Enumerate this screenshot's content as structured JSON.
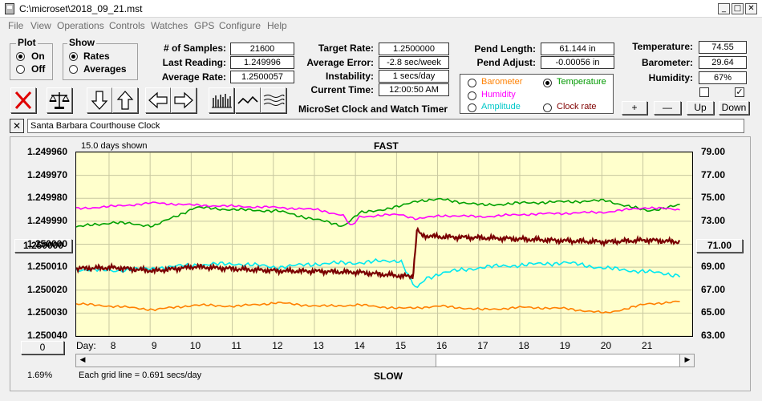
{
  "window": {
    "title": "C:\\microset\\2018_09_21.mst",
    "min_label": "_",
    "max_label": "□",
    "close_label": "✕"
  },
  "menu": [
    "File",
    "View",
    "Operations",
    "Controls",
    "Watches",
    "GPS",
    "Configure",
    "Help"
  ],
  "plot_group": {
    "title": "Plot",
    "on_label": "On",
    "off_label": "Off",
    "selected": "On"
  },
  "show_group": {
    "title": "Show",
    "rates_label": "Rates",
    "averages_label": "Averages",
    "selected": "Rates"
  },
  "stats": {
    "samples_label": "# of Samples:",
    "samples": "21600",
    "last_reading_label": "Last Reading:",
    "last_reading": "1.249996",
    "average_rate_label": "Average Rate:",
    "average_rate": "1.2500057",
    "target_rate_label": "Target Rate:",
    "target_rate": "1.2500000",
    "average_error_label": "Average Error:",
    "average_error": "-2.8 sec/week",
    "instability_label": "Instability:",
    "instability": "1 secs/day",
    "current_time_label": "Current Time:",
    "current_time": "12:00:50 AM",
    "pend_length_label": "Pend Length:",
    "pend_length": "61.144 in",
    "pend_adjust_label": "Pend Adjust:",
    "pend_adjust": "-0.00056 in",
    "temperature_label": "Temperature:",
    "temperature": "74.55",
    "barometer_label": "Barometer:",
    "barometer": "29.64",
    "humidity_label": "Humidity:",
    "humidity": "67%"
  },
  "app_name": "MicroSet Clock and Watch Timer",
  "sensors": {
    "barometer": {
      "label": "Barometer",
      "color": "#ff8000"
    },
    "temperature": {
      "label": "Temperature",
      "color": "#009900"
    },
    "humidity": {
      "label": "Humidity",
      "color": "#ff00ff"
    },
    "amplitude": {
      "label": "Amplitude",
      "color": "#00c8c8"
    },
    "clock_rate": {
      "label": "Clock rate",
      "color": "#800000"
    },
    "selected": "Temperature"
  },
  "scale_buttons": {
    "plus": "+",
    "minus": "—",
    "up": "Up",
    "down": "Down"
  },
  "checkboxes": {
    "left_checked": false,
    "right_checked": true
  },
  "toolbar_icons": [
    "clear-x-icon",
    "balance-scale-icon",
    "arrow-down-icon",
    "arrow-up-icon",
    "arrow-left-icon",
    "arrow-right-icon",
    "bar-graph-icon",
    "line-graph-icon",
    "smooth-graph-icon"
  ],
  "clock_name": "Santa Barbara Courthouse Clock",
  "clock_name_clear": "✕",
  "chart_data": {
    "type": "line",
    "title": "FAST",
    "bottom_label": "SLOW",
    "days_shown": "15.0 days shown",
    "grid_note": "Each grid line = 0.691 secs/day",
    "percent": "1.69%",
    "left_button": "1.250000",
    "left_bottom_button": "0",
    "right_button": "71.00",
    "x_label": "Day:",
    "x_ticks": [
      "8",
      "9",
      "10",
      "11",
      "12",
      "13",
      "14",
      "15",
      "16",
      "17",
      "18",
      "19",
      "20",
      "21"
    ],
    "x_range": [
      7.1,
      22.1
    ],
    "left_axis": {
      "ticks": [
        "1.249960",
        "1.249970",
        "1.249980",
        "1.249990",
        "1.250000",
        "1.250010",
        "1.250020",
        "1.250030",
        "1.250040"
      ],
      "range": [
        1.24996,
        1.25004
      ],
      "inverted": true
    },
    "right_axis": {
      "ticks": [
        "79.00",
        "77.00",
        "75.00",
        "73.00",
        "71.00",
        "69.00",
        "67.00",
        "65.00",
        "63.00"
      ],
      "range": [
        63,
        79
      ]
    },
    "grid": true,
    "series": [
      {
        "name": "Temperature",
        "color": "#00a000",
        "axis": "right",
        "x": [
          7.1,
          8,
          9,
          10,
          11,
          12,
          13,
          13.6,
          14,
          15,
          15.4,
          16,
          17,
          18,
          19,
          20,
          21,
          21.8
        ],
        "y": [
          72.5,
          72.9,
          72.6,
          74.2,
          74.0,
          73.9,
          73.1,
          72.6,
          73.7,
          74.3,
          74.8,
          74.9,
          74.4,
          74.6,
          74.7,
          74.8,
          73.9,
          74.4
        ]
      },
      {
        "name": "Humidity",
        "color": "#ff00ff",
        "axis": "right",
        "x": [
          7.1,
          8,
          9,
          10,
          11,
          12,
          13,
          13.6,
          13.8,
          14,
          15,
          15.4,
          16,
          17,
          18,
          19,
          20,
          21,
          21.8
        ],
        "y": [
          74.1,
          74.3,
          74.6,
          74.4,
          74.3,
          74.2,
          74.0,
          73.5,
          72.5,
          73.4,
          73.6,
          73.2,
          73.5,
          73.4,
          73.6,
          73.7,
          73.8,
          74.2,
          74.0
        ]
      },
      {
        "name": "Amplitude",
        "color": "#00e8f0",
        "axis": "right",
        "x": [
          7.1,
          8,
          9,
          10,
          11,
          12,
          13,
          14,
          15,
          15.3,
          15.4,
          15.6,
          16,
          17,
          18,
          19,
          20,
          21,
          21.8
        ],
        "y": [
          68.8,
          68.7,
          68.9,
          69.2,
          69.3,
          69.0,
          69.3,
          69.4,
          69.6,
          67.5,
          67.1,
          68.0,
          68.5,
          69.0,
          69.2,
          69.4,
          68.9,
          68.6,
          68.3
        ]
      },
      {
        "name": "Barometer",
        "color": "#ff8000",
        "axis": "right",
        "x": [
          7.1,
          8,
          9,
          10,
          11,
          12,
          13,
          14,
          15,
          16,
          17,
          18,
          19,
          20,
          21,
          21.8
        ],
        "y": [
          65.8,
          65.6,
          65.3,
          65.7,
          65.6,
          65.9,
          65.6,
          65.7,
          65.4,
          65.6,
          65.3,
          65.5,
          65.4,
          65.0,
          65.8,
          66.0
        ]
      },
      {
        "name": "Clock rate",
        "color": "#7a0000",
        "axis": "left",
        "x": [
          7.1,
          8,
          9,
          10,
          11,
          12,
          13,
          14,
          15,
          15.3,
          15.4,
          15.5,
          16,
          17,
          18,
          19,
          20,
          21,
          21.8
        ],
        "y": [
          1.2500106,
          1.2500102,
          1.2500116,
          1.2500098,
          1.2500108,
          1.2500116,
          1.2500118,
          1.2500123,
          1.2500138,
          1.250014,
          1.2499934,
          1.2499962,
          1.2499968,
          1.2499972,
          1.2499978,
          1.2499985,
          1.249999,
          1.2499982,
          1.249999
        ]
      }
    ]
  }
}
